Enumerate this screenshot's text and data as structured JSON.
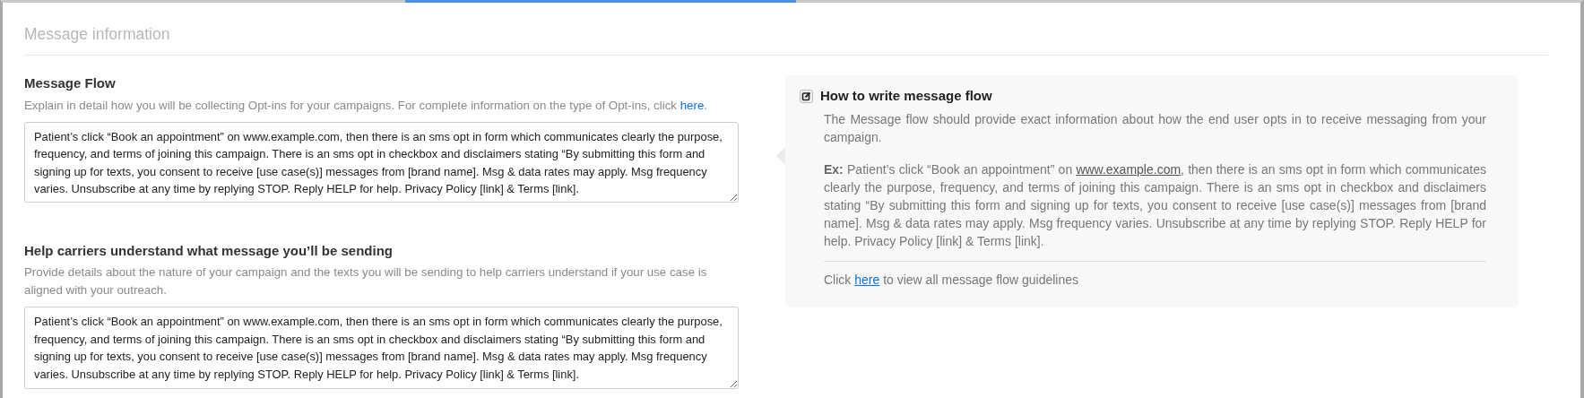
{
  "section_title": "Message information",
  "fields": [
    {
      "label": "Message Flow",
      "description": {
        "text": "Explain in detail how you will be collecting Opt-ins for your campaigns. For complete information on the type of Opt-ins, click ",
        "link": "here",
        "after": "."
      },
      "value": "Patient’s click “Book an appointment” on www.example.com, then there is an sms opt in form which communicates clearly the purpose, frequency, and terms of joining this campaign. There is an sms opt in checkbox and disclaimers stating “By submitting this form and signing up for texts, you consent to receive [use case(s)] messages from [brand name]. Msg & data rates may apply. Msg frequency varies. Unsubscribe at any time by replying STOP. Reply HELP for help. Privacy Policy [link] & Terms [link]."
    },
    {
      "label": "Help carriers understand what message you’ll be sending",
      "description": {
        "text": "Provide details about the nature of your campaign and the texts you will be sending to help carriers understand if your use case is aligned with your outreach."
      },
      "value": "Patient’s click “Book an appointment” on www.example.com, then there is an sms opt in form which communicates clearly the purpose, frequency, and terms of joining this campaign. There is an sms opt in checkbox and disclaimers stating “By submitting this form and signing up for texts, you consent to receive [use case(s)] messages from [brand name]. Msg & data rates may apply. Msg frequency varies. Unsubscribe at any time by replying STOP. Reply HELP for help. Privacy Policy [link] & Terms [link]."
    }
  ],
  "help_card": {
    "title": "How to write message flow",
    "intro": "The Message flow should provide exact information about how the end user opts in to receive messaging from your campaign.",
    "example": {
      "label": "Ex:",
      "before": " Patient’s click “Book an appointment” on ",
      "link": "www.example.com",
      "after": ", then there is an sms opt in form which communicates clearly the purpose, frequency, and terms of joining this campaign. There is an sms opt in checkbox and disclaimers stating “By submitting this form and signing up for texts, you consent to receive [use case(s)] messages from [brand name]. Msg & data rates may apply. Msg frequency varies. Unsubscribe at any time by replying STOP. Reply HELP for help. Privacy Policy [link] & Terms [link]."
    },
    "footer": {
      "before": "Click ",
      "link": "here",
      "after": " to view all message flow guidelines"
    }
  }
}
